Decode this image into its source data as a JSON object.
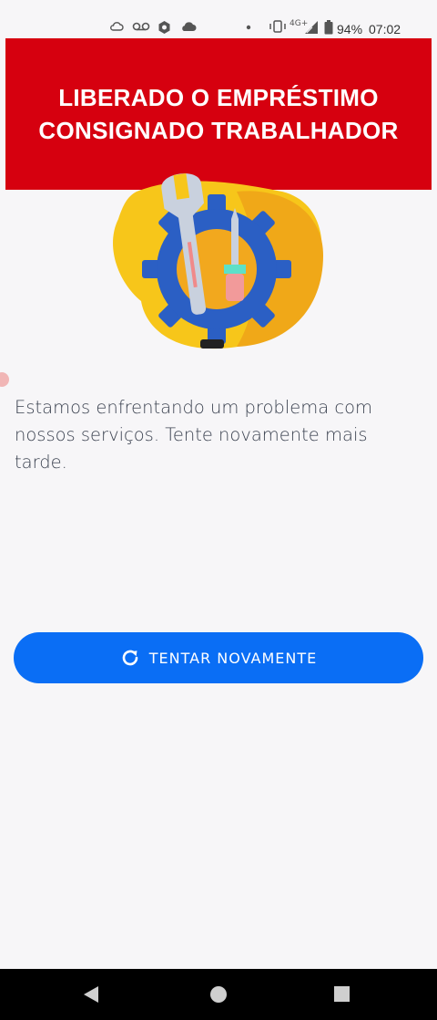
{
  "status_bar": {
    "battery": "94%",
    "time": "07:02",
    "network": "4G+",
    "icons": [
      "cloud-outline-icon",
      "voicemail-icon",
      "app-icon",
      "cloud-icon",
      "dot-icon",
      "vibrate-icon",
      "signal-icon",
      "battery-icon"
    ]
  },
  "banner": {
    "line1": "LIBERADO O EMPRÉSTIMO",
    "line2": "CONSIGNADO TRABALHADOR",
    "background": "#d6000f"
  },
  "illustration": {
    "icon": "tools-gear-icon"
  },
  "error": {
    "message": "Estamos enfrentando um problema com nossos serviços. Tente novamente mais tarde."
  },
  "retry_button": {
    "label": "TENTAR NOVAMENTE",
    "icon": "refresh-icon",
    "color": "#0a6ef5"
  },
  "navigation": {
    "items": [
      "back-icon",
      "home-icon",
      "recents-icon"
    ]
  }
}
